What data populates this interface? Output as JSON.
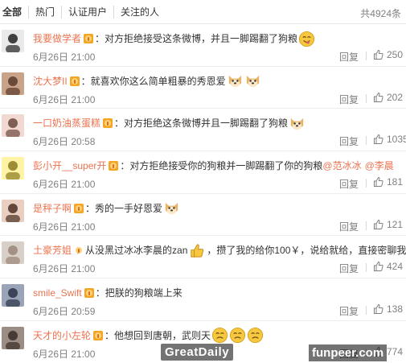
{
  "tabs": [
    {
      "label": "全部"
    },
    {
      "label": "热门"
    },
    {
      "label": "认证用户"
    },
    {
      "label": "关注的人"
    }
  ],
  "total_count": "共4924条",
  "reply_label": "回复",
  "comments": [
    {
      "user": "我要做学者",
      "text": "：对方拒绝接受这条微博，并且一脚踢翻了狗粮",
      "time": "6月26日 21:00",
      "likes": "250",
      "emojis": [
        "yummy-emoji"
      ]
    },
    {
      "user": "沈大梦II",
      "text": "：就喜欢你这么简单粗暴的秀恩爱",
      "time": "6月26日 21:00",
      "likes": "202",
      "emojis": [
        "doge-emoji",
        "doge-emoji"
      ]
    },
    {
      "user": "一口奶油蒸蛋糕",
      "text": "：对方拒绝这条微博并且一脚踢翻了狗粮",
      "time": "6月26日 20:58",
      "likes": "1035",
      "emojis": [
        "doge-emoji"
      ]
    },
    {
      "user": "彭小开__super开",
      "text": "：对方拒绝接受你的狗粮并一脚踢翻了你的狗粮",
      "mentions": [
        "@范冰冰",
        "@李晨"
      ],
      "time": "6月26日 21:00",
      "likes": "181",
      "emojis": []
    },
    {
      "user": "是秤子啊",
      "text": "：秀的一手好恩爱",
      "time": "6月26日 21:00",
      "likes": "121",
      "emojis": [
        "doge-emoji"
      ]
    },
    {
      "user": "土豪芳姐",
      "text": "：从没黑过冰冰李晨的zan",
      "text2": "，攒了我的给你100￥，说给就给，直接密聊我",
      "time": "6月26日 21:00",
      "likes": "424",
      "emojis": [
        "thumbs-up-emoji"
      ]
    },
    {
      "user": "smile_Swift",
      "text": "：把朕的狗粮端上来",
      "time": "6月26日 20:59",
      "likes": "138",
      "emojis": []
    },
    {
      "user": "天才的小左轮",
      "text": "：他想回到唐朝，武则天",
      "time": "6月26日 21:00",
      "likes": "774",
      "emojis": [
        "frown-emoji",
        "frown-emoji",
        "frown-emoji"
      ]
    }
  ],
  "watermarks": {
    "left": "GreatDaily",
    "right": "funpeer.com"
  },
  "colors": {
    "username": "#eb7350",
    "meta": "#808080",
    "text": "#333333",
    "emoji": "#f7c740"
  }
}
